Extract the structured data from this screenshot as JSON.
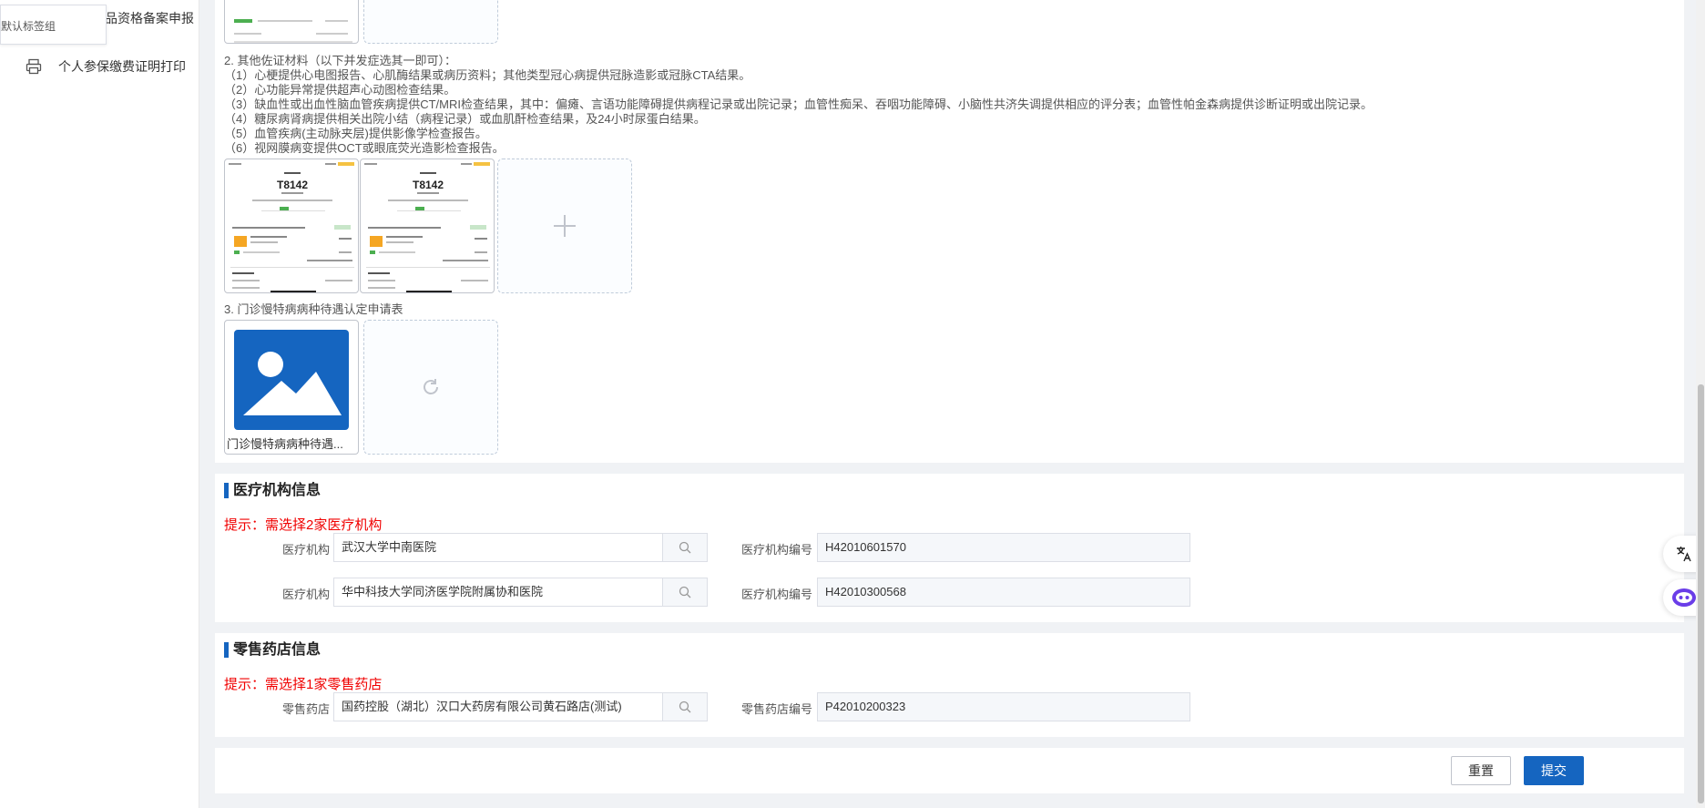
{
  "sidebar": {
    "tab_tooltip": "默认标签组",
    "top_item": "品资格备案申报",
    "item_print": "个人参保缴费证明打印"
  },
  "materials": {
    "other_title": "2. 其他佐证材料（以下并发症选其一即可）：",
    "lines": [
      "（1）心梗提供心电图报告、心肌酶结果或病历资料；其他类型冠心病提供冠脉造影或冠脉CTA结果。",
      "（2）心功能异常提供超声心动图检查结果。",
      "（3）缺血性或出血性脑血管疾病提供CT/MRI检查结果，其中：偏瘫、言语功能障碍提供病程记录或出院记录；血管性痴呆、吞咽功能障碍、小脑性共济失调提供相应的评分表；血管性帕金森病提供诊断证明或出院记录。",
      "（4）糖尿病肾病提供相关出院小结（病程记录）或血肌酐检查结果，及24小时尿蛋白结果。",
      "（5）血管疾病(主动脉夹层)提供影像学检查报告。",
      "（6）视网膜病变提供OCT或眼底荧光造影检查报告。"
    ],
    "app_form_title": "3. 门诊慢特病病种待遇认定申请表",
    "file_caption": "门诊慢特病病种待遇...",
    "thumb_header": "T8142"
  },
  "medical": {
    "section_title": "医疗机构信息",
    "tip": "提示：需选择2家医疗机构",
    "label_org": "医疗机构",
    "label_code": "医疗机构编号",
    "rows": [
      {
        "org": "武汉大学中南医院",
        "code": "H42010601570"
      },
      {
        "org": "华中科技大学同济医学院附属协和医院",
        "code": "H42010300568"
      }
    ]
  },
  "pharmacy": {
    "section_title": "零售药店信息",
    "tip": "提示：需选择1家零售药店",
    "label_store": "零售药店",
    "label_code": "零售药店编号",
    "store": "国药控股（湖北）汉口大药房有限公司黄石路店(测试)",
    "code": "P42010200323"
  },
  "actions": {
    "reset": "重置",
    "submit": "提交"
  },
  "colors": {
    "primary": "#1565c0",
    "tip": "#f00000"
  }
}
